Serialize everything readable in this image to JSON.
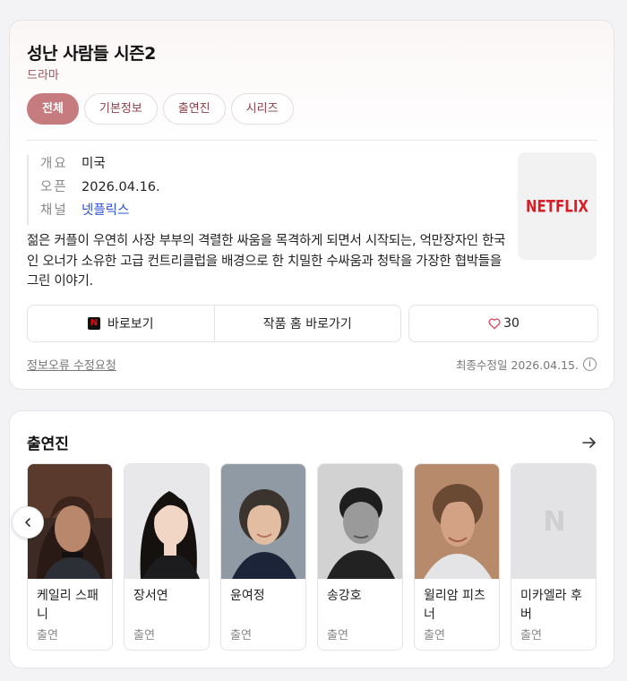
{
  "info": {
    "title": "성난 사람들 시즌2",
    "genre": "드라마",
    "tabs": [
      {
        "label": "전체",
        "active": true
      },
      {
        "label": "기본정보",
        "active": false
      },
      {
        "label": "출연진",
        "active": false
      },
      {
        "label": "시리즈",
        "active": false
      }
    ],
    "facts": [
      {
        "key": "개요",
        "value": "미국"
      },
      {
        "key": "오픈",
        "value": "2026.04.16."
      },
      {
        "key": "채널",
        "value": "넷플릭스"
      }
    ],
    "logo_text": "NETFLIX",
    "description": "젊은 커플이 우연히 사장 부부의 격렬한 싸움을 목격하게 되면서 시작되는, 억만장자인 한국인 오너가 소유한 고급 컨트리클럽을 배경으로 한 치밀한 수싸움과 청탁을 가장한 협박들을 그린 이야기.",
    "actions": {
      "watch_label": "바로보기",
      "watch_icon_text": "N",
      "home_label": "작품 홈 바로가기",
      "like_count": "30"
    },
    "report_label": "정보오류 수정요청",
    "updated_label": "최종수정일 2026.04.15.",
    "info_icon_text": "i"
  },
  "cast_section": {
    "title": "출연진",
    "members": [
      {
        "name": "케일리 스패니",
        "role": "출연"
      },
      {
        "name": "장서연",
        "role": "출연"
      },
      {
        "name": "윤여정",
        "role": "출연"
      },
      {
        "name": "송강호",
        "role": "출연"
      },
      {
        "name": "윌리암 피츠너",
        "role": "출연"
      },
      {
        "name": "미카엘라 후버",
        "role": "출연",
        "placeholder": "N"
      }
    ]
  },
  "colors": {
    "accent": "#c67b7f",
    "link": "#2b4fd8",
    "netflix_red": "#d81f26"
  }
}
